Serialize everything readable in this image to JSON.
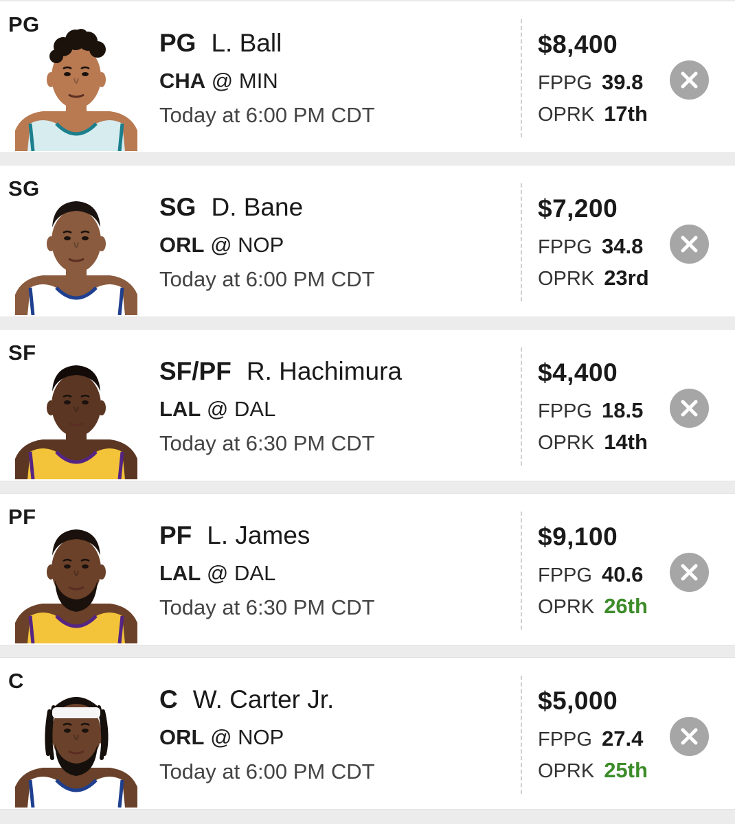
{
  "colors": {
    "background": "#ececec",
    "card": "#ffffff",
    "text": "#1a1a1a",
    "muted": "#444444",
    "good_rank": "#3d8c2a",
    "remove_button": "#a6a6a6"
  },
  "lineup": [
    {
      "slot": "PG",
      "position": "PG",
      "name": "L. Ball",
      "team": "CHA",
      "at": "@",
      "opponent": "MIN",
      "time": "Today at 6:00 PM CDT",
      "salary": "$8,400",
      "fppg_label": "FPPG",
      "fppg": "39.8",
      "oprk_label": "OPRK",
      "oprk": "17th",
      "oprk_color": "#1a1a1a",
      "photo": {
        "skin": "#b97a52",
        "hair": "#1b120c",
        "jersey": "#d6ecef",
        "trim": "#1b7f8d",
        "hair_style": "curly"
      }
    },
    {
      "slot": "SG",
      "position": "SG",
      "name": "D. Bane",
      "team": "ORL",
      "at": "@",
      "opponent": "NOP",
      "time": "Today at 6:00 PM CDT",
      "salary": "$7,200",
      "fppg_label": "FPPG",
      "fppg": "34.8",
      "oprk_label": "OPRK",
      "oprk": "23rd",
      "oprk_color": "#1a1a1a",
      "photo": {
        "skin": "#8a5b3e",
        "hair": "#1a1310",
        "jersey": "#ffffff",
        "trim": "#1f3f8f",
        "hair_style": "short"
      }
    },
    {
      "slot": "SF",
      "position": "SF/PF",
      "name": "R. Hachimura",
      "team": "LAL",
      "at": "@",
      "opponent": "DAL",
      "time": "Today at 6:30 PM CDT",
      "salary": "$4,400",
      "fppg_label": "FPPG",
      "fppg": "18.5",
      "oprk_label": "OPRK",
      "oprk": "14th",
      "oprk_color": "#1a1a1a",
      "photo": {
        "skin": "#5b3623",
        "hair": "#120b08",
        "jersey": "#f3c43a",
        "trim": "#552583",
        "hair_style": "short"
      }
    },
    {
      "slot": "PF",
      "position": "PF",
      "name": "L. James",
      "team": "LAL",
      "at": "@",
      "opponent": "DAL",
      "time": "Today at 6:30 PM CDT",
      "salary": "$9,100",
      "fppg_label": "FPPG",
      "fppg": "40.6",
      "oprk_label": "OPRK",
      "oprk": "26th",
      "oprk_color": "#3d8c2a",
      "photo": {
        "skin": "#6b4129",
        "hair": "#1a110c",
        "jersey": "#f3c43a",
        "trim": "#552583",
        "hair_style": "beard"
      }
    },
    {
      "slot": "C",
      "position": "C",
      "name": "W. Carter Jr.",
      "team": "ORL",
      "at": "@",
      "opponent": "NOP",
      "time": "Today at 6:00 PM CDT",
      "salary": "$5,000",
      "fppg_label": "FPPG",
      "fppg": "27.4",
      "oprk_label": "OPRK",
      "oprk": "25th",
      "oprk_color": "#3d8c2a",
      "photo": {
        "skin": "#6a412a",
        "hair": "#16100c",
        "jersey": "#ffffff",
        "trim": "#1f3f8f",
        "hair_style": "locs"
      }
    }
  ]
}
